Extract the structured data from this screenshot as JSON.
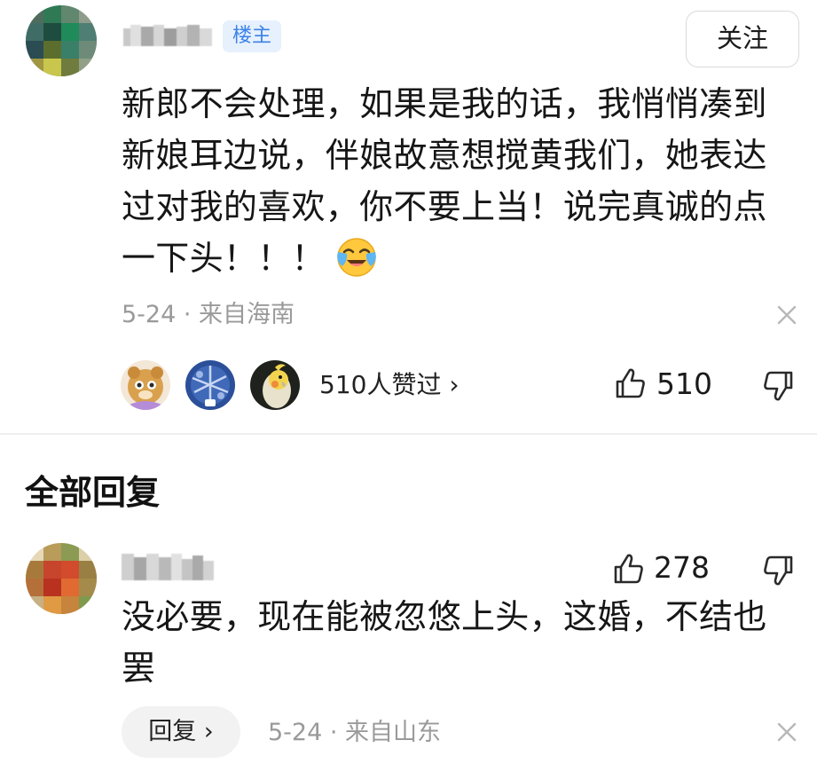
{
  "post": {
    "op_badge": "楼主",
    "follow_label": "关注",
    "content": "新郎不会处理，如果是我的话，我悄悄凑到新娘耳边说，伴娘故意想搅黄我们，她表达过对我的喜欢，你不要上当！说完真诚的点一下头！！！",
    "emoji": "crying-laughing-emoji",
    "meta": "5-24 · 来自海南",
    "likers_text": "510人赞过 ›",
    "like_count": "510"
  },
  "replies": {
    "section_title": "全部回复",
    "items": [
      {
        "content": "没必要，现在能被忽悠上头，这婚，不结也罢",
        "like_count": "278",
        "reply_label": "回复 ›",
        "meta": "5-24 · 来自山东"
      }
    ]
  },
  "icons": {
    "thumb_up": "thumb-up-icon",
    "thumb_down": "thumb-down-icon",
    "close": "close-icon"
  },
  "colors": {
    "badge_text": "#3b82e8",
    "badge_bg": "#e7f1fd",
    "meta_text": "#9a9a9a"
  }
}
